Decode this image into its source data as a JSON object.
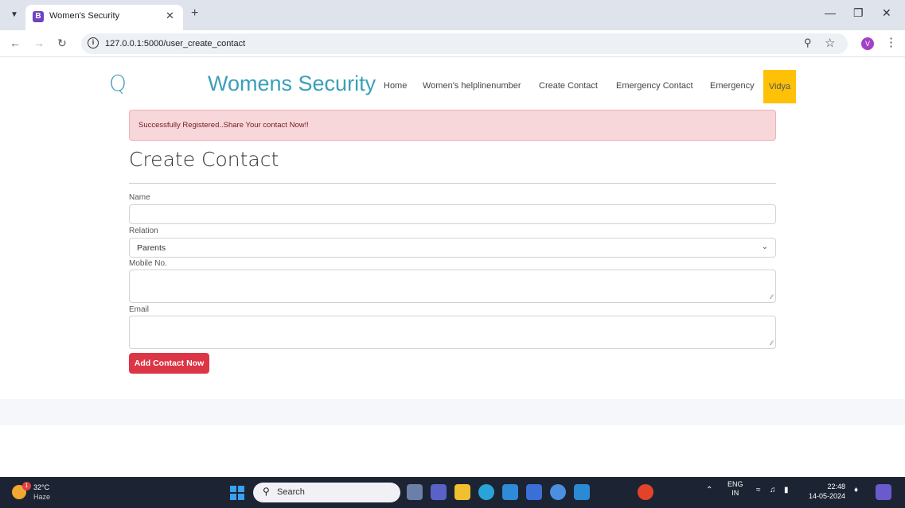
{
  "browser": {
    "tab_title": "Women's Security",
    "tab_favicon_letter": "B",
    "url": "127.0.0.1:5000/user_create_contact",
    "profile_initial": "V"
  },
  "nav": {
    "brand": "Womens Security",
    "logo_icon": "q-logo-icon",
    "links": [
      "Home",
      "Women's helplinenumber",
      "Create Contact",
      "Emergency Contact",
      "Emergency"
    ],
    "user": "Vidya"
  },
  "alert": {
    "message": "Successfully Registered..Share Your contact Now!!"
  },
  "form": {
    "title": "Create Contact",
    "name_label": "Name",
    "name_value": "",
    "relation_label": "Relation",
    "relation_value": "Parents",
    "mobile_label": "Mobile No.",
    "mobile_value": "",
    "email_label": "Email",
    "email_value": "",
    "submit_label": "Add Contact Now"
  },
  "taskbar": {
    "weather_temp": "32°C",
    "weather_desc": "Haze",
    "weather_badge": "1",
    "search_placeholder": "Search",
    "lang_top": "ENG",
    "lang_bottom": "IN",
    "time": "22:48",
    "date": "14-05-2024"
  },
  "colors": {
    "brand": "#3aa0b8",
    "alert_bg": "#f8d7da",
    "button": "#dc3545",
    "user_badge": "#ffc107"
  }
}
